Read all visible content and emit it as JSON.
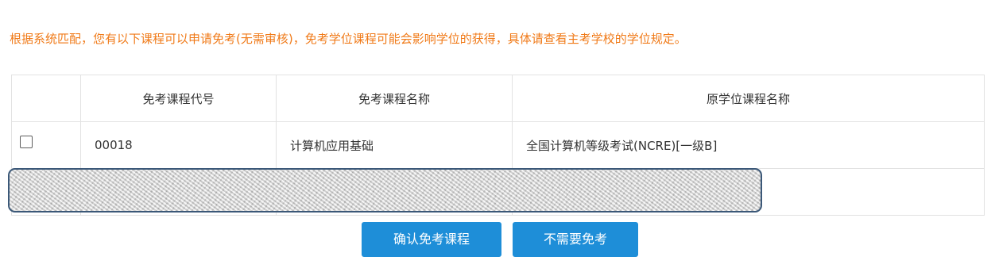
{
  "notice": "根据系统匹配，您有以下课程可以申请免考(无需审核)，免考学位课程可能会影响学位的获得，具体请查看主考学校的学位规定。",
  "table": {
    "headers": [
      "",
      "免考课程代号",
      "免考课程名称",
      "原学位课程名称"
    ],
    "rows": [
      {
        "code": "00018",
        "name": "计算机应用基础",
        "original": "全国计算机等级考试(NCRE)[一级B]"
      }
    ]
  },
  "buttons": {
    "confirm": "确认免考课程",
    "skip": "不需要免考"
  },
  "colors": {
    "notice_text": "#f07a18",
    "button_bg": "#1e8ed8",
    "table_border": "#e2e2e2",
    "redaction_border": "#3b5878"
  }
}
